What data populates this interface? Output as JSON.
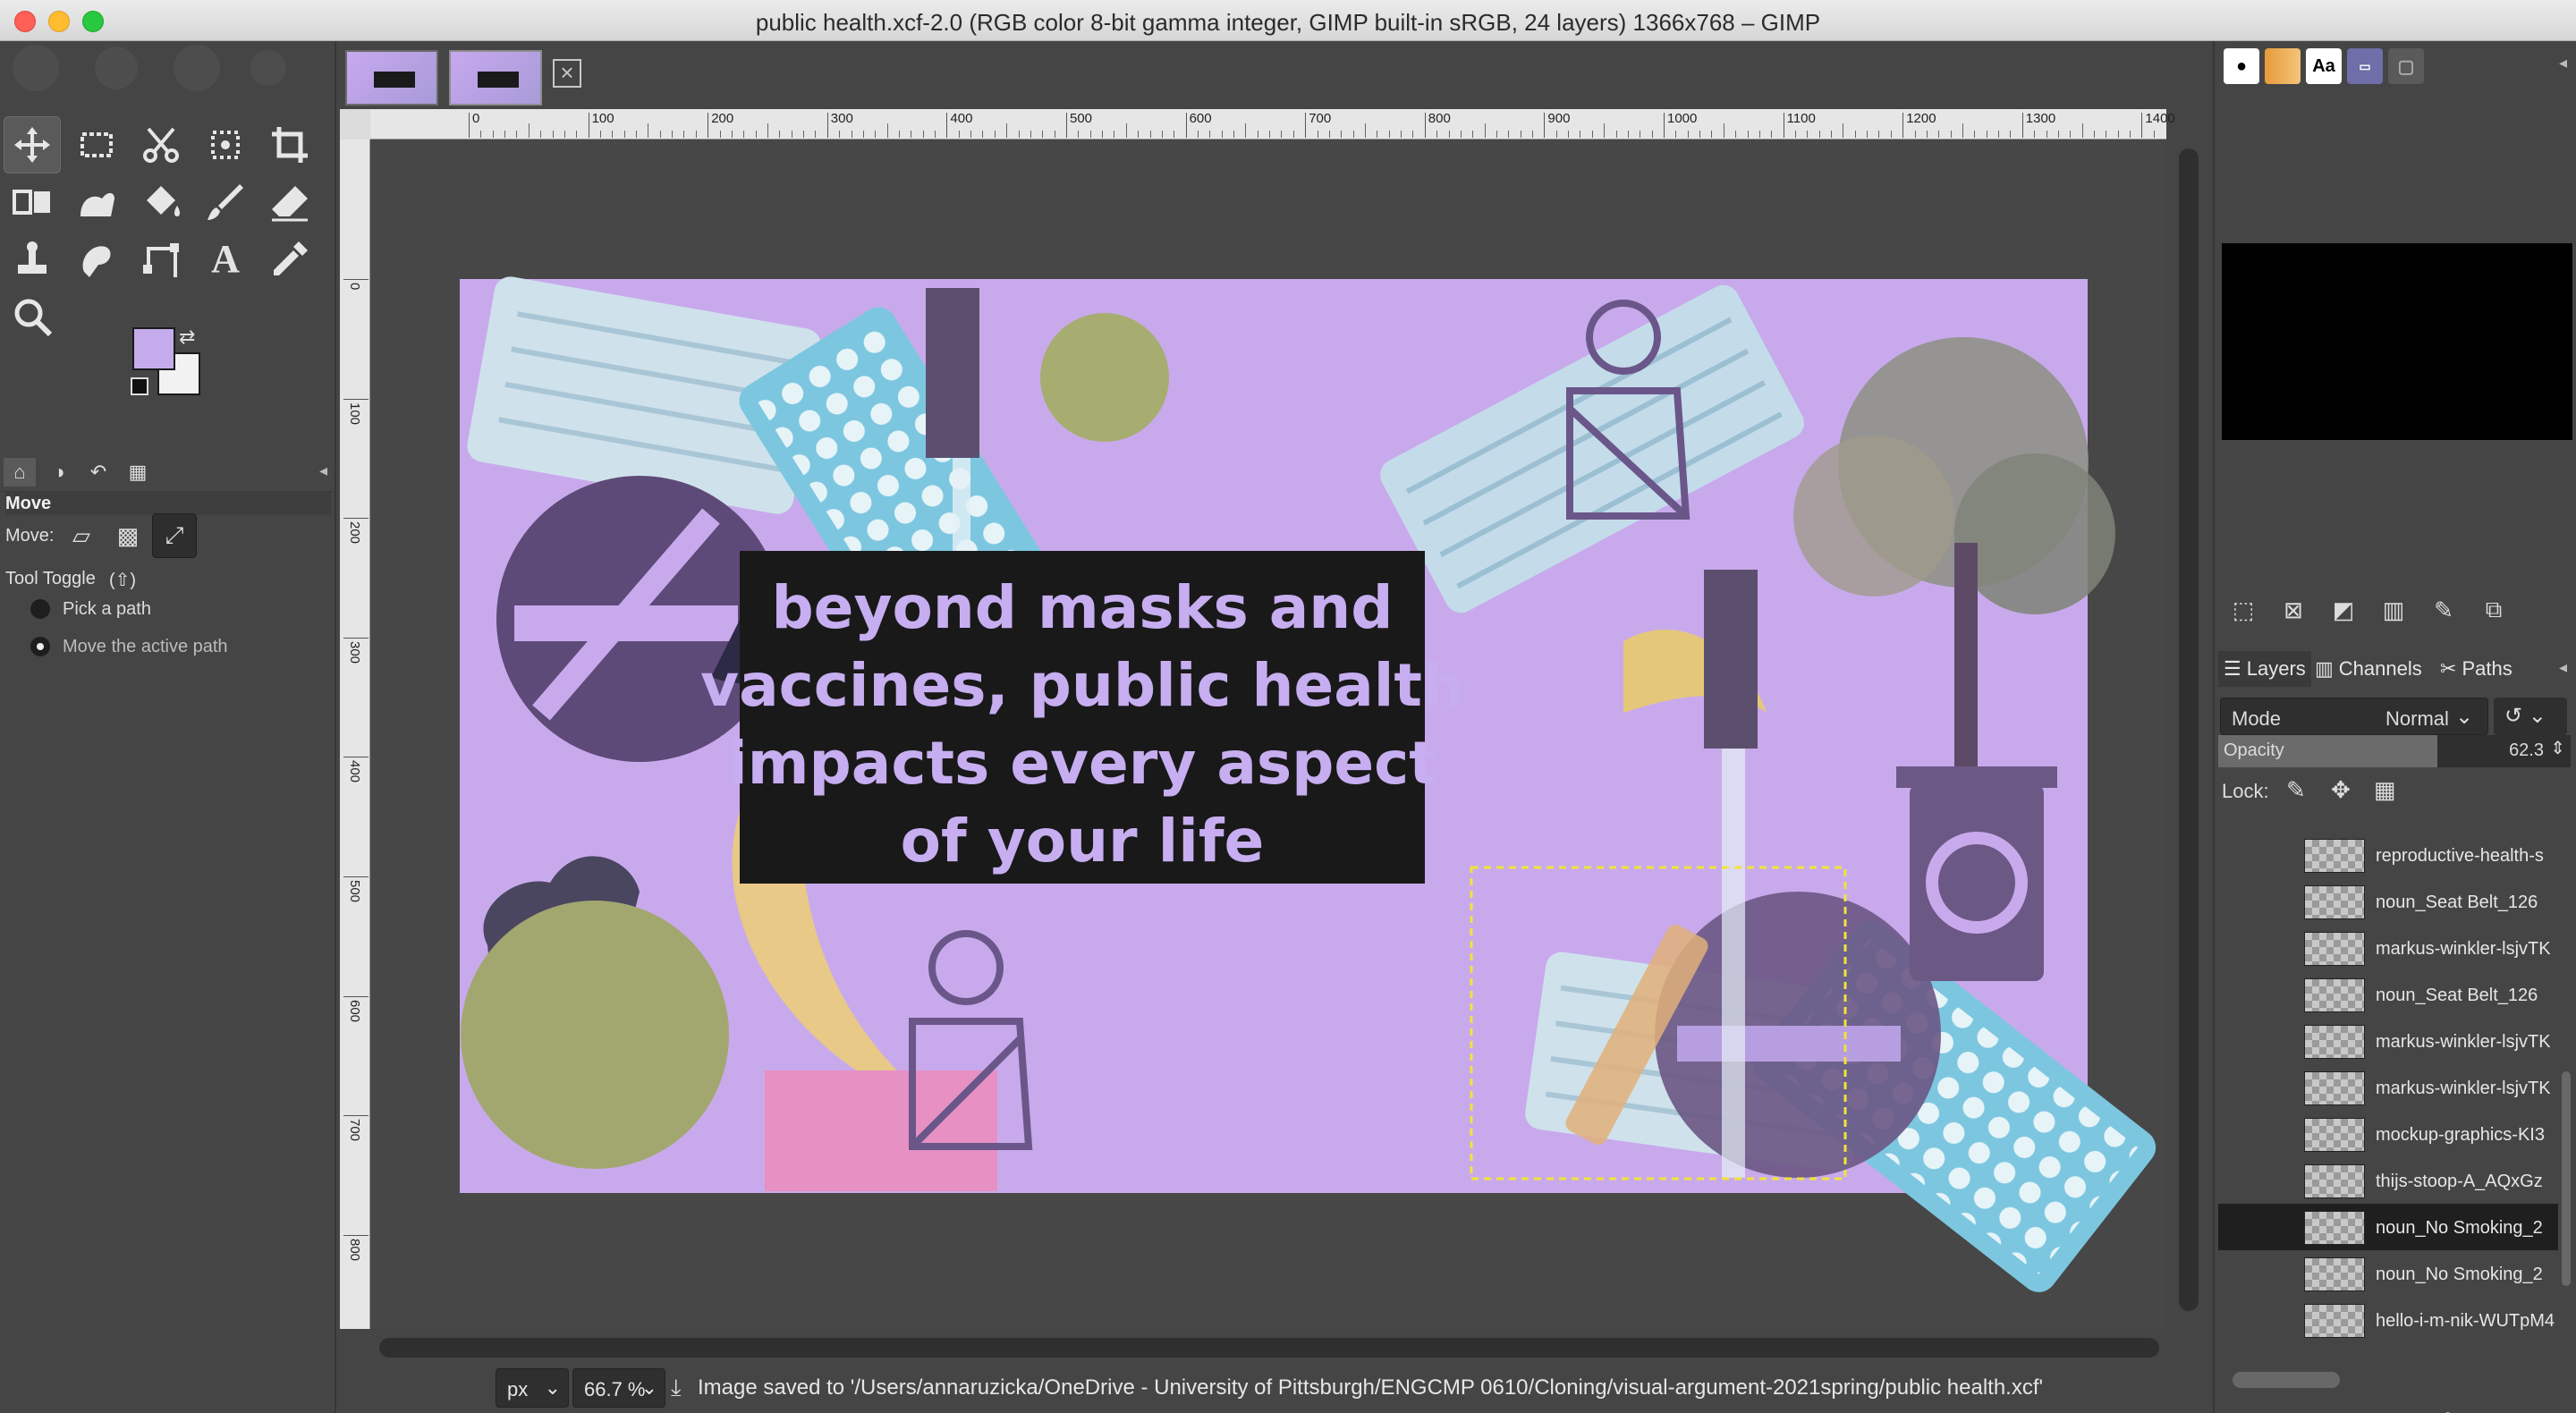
{
  "window": {
    "title": "public health.xcf-2.0 (RGB color 8-bit gamma integer, GIMP built-in sRGB, 24 layers) 1366x768 – GIMP"
  },
  "toolbox": {
    "tools": [
      "move-tool",
      "rect-select-tool",
      "scissors-tool",
      "fuzzy-select-tool",
      "crop-tool",
      "unified-transform-tool",
      "warp-transform-tool",
      "bucket-fill-tool",
      "paintbrush-tool",
      "eraser-tool",
      "clone-tool",
      "smudge-tool",
      "paths-tool",
      "text-tool",
      "color-picker-tool",
      "zoom-tool"
    ],
    "text_tool_glyph": "A",
    "fg_color": "#c4acec",
    "bg_color": "#f2f2f2"
  },
  "tool_options": {
    "header": "Move",
    "move_label": "Move:",
    "tool_toggle_label": "Tool Toggle",
    "tool_toggle_shortcut": "(⇧)",
    "radio_options": [
      "Pick a path",
      "Move the active path"
    ],
    "selected_option": "Move the active path"
  },
  "ruler": {
    "h_ticks": [
      "0",
      "100",
      "200",
      "300",
      "400",
      "500",
      "600",
      "700",
      "800",
      "900",
      "1000",
      "1100",
      "1200",
      "1300",
      "1400"
    ],
    "v_ticks": [
      "0",
      "100",
      "200",
      "300",
      "400",
      "500",
      "600",
      "700",
      "800"
    ]
  },
  "canvas": {
    "headline": [
      "beyond masks and",
      "vaccines, public health",
      "impacts every aspect",
      "of your life"
    ],
    "bg_color": "#c8aaec",
    "text_color": "#c6aef0",
    "box_color": "#191919"
  },
  "statusbar": {
    "unit": "px",
    "zoom": "66.7 %",
    "message": "Image saved to '/Users/annaruzicka/OneDrive - University of Pittsburgh/ENGCMP 0610/Cloning/visual-argument-2021spring/public health.xcf'"
  },
  "right_dock": {
    "brush_tabs": [
      "brush",
      "gradient",
      "Aa",
      "pattern",
      "document"
    ],
    "layer_tabs": [
      "Layers",
      "Channels",
      "Paths"
    ],
    "mode_label": "Mode",
    "mode_value": "Normal",
    "opacity_label": "Opacity",
    "opacity_value": "62.3",
    "opacity_fraction": 0.623,
    "lock_label": "Lock:",
    "layers": [
      {
        "name": "reproductive-health-s"
      },
      {
        "name": "noun_Seat Belt_126"
      },
      {
        "name": "markus-winkler-lsjvTK"
      },
      {
        "name": "noun_Seat Belt_126"
      },
      {
        "name": "markus-winkler-lsjvTK"
      },
      {
        "name": "markus-winkler-lsjvTK"
      },
      {
        "name": "mockup-graphics-KI3"
      },
      {
        "name": "thijs-stoop-A_AQxGz"
      },
      {
        "name": "noun_No Smoking_2"
      },
      {
        "name": "noun_No Smoking_2"
      },
      {
        "name": "hello-i-m-nik-WUTpM4"
      }
    ],
    "selected_layer": 8
  }
}
